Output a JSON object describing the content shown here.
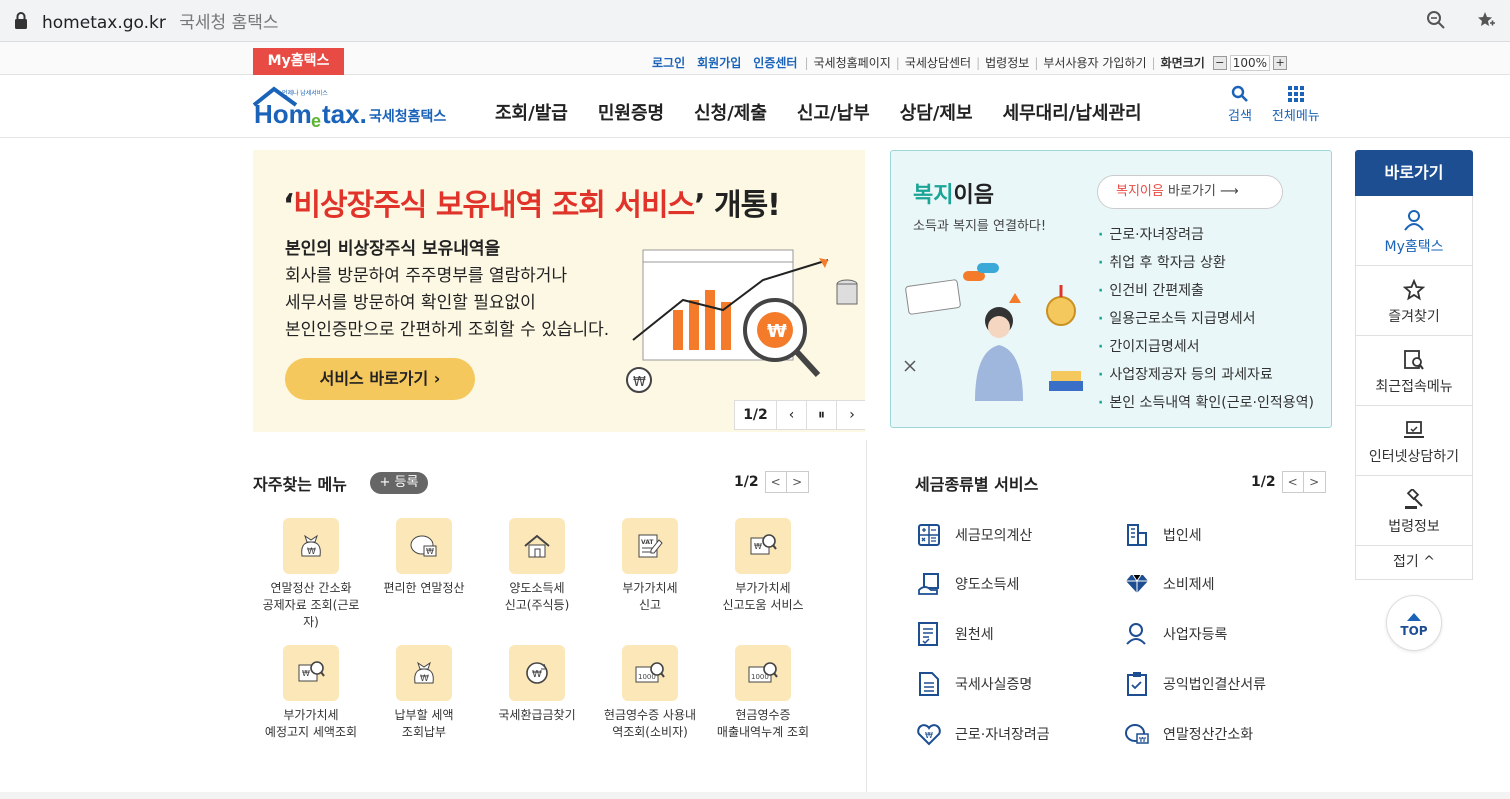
{
  "browser": {
    "host": "hometax.go.kr",
    "title": "국세청 홈택스"
  },
  "topbar": {
    "my_tab": "My홈택스",
    "links_bold": [
      "로그인",
      "회원가입",
      "인증센터"
    ],
    "links": [
      "국세청홈페이지",
      "국세상담센터",
      "법령정보",
      "부서사용자 가입하기"
    ],
    "zoom_label": "화면크기",
    "zoom_value": "100%"
  },
  "logo": {
    "small": "언제나 납세서비스",
    "main": "Hometax.",
    "sub": "국세청홈택스"
  },
  "nav": [
    "조회/발급",
    "민원증명",
    "신청/제출",
    "신고/납부",
    "상담/제보",
    "세무대리/납세관리"
  ],
  "gnb_icons": {
    "search": "검색",
    "all_menu": "전체메뉴"
  },
  "banner": {
    "title_pre": "‘",
    "title_red": "비상장주식 보유내역 조회 서비스",
    "title_post": "’ 개통!",
    "line1": "본인의 비상장주식 보유내역을",
    "line2": "회사를 방문하여 주주명부를 열람하거나",
    "line3": "세무서를 방문하여 확인할 필요없이",
    "line4": "본인인증만으로 간편하게 조회할 수 있습니다.",
    "button": "서비스 바로가기 ›",
    "page": "1/2",
    "prev": "‹",
    "pause": "⏸",
    "next": "›"
  },
  "welfare": {
    "title_green": "복지",
    "title_rest": "이음",
    "subtitle": "소득과 복지를 연결하다!",
    "btn_red": "복지이음",
    "btn_rest": " 바로가기 ⟶",
    "items": [
      "근로·자녀장려금",
      "취업 후 학자금 상환",
      "인건비 간편제출",
      "일용근로소득 지급명세서",
      "간이지급명세서",
      "사업장제공자 등의 과세자료",
      "본인 소득내역 확인(근로·인적용역)"
    ]
  },
  "quick": {
    "header": "바로가기",
    "items": [
      "My홈택스",
      "즐겨찾기",
      "최근접속메뉴",
      "인터넷상담하기",
      "법령정보"
    ],
    "fold": "접기 ^",
    "top": "TOP"
  },
  "frequent": {
    "title": "자주찾는 메뉴",
    "register": "+ 등록",
    "page": "1/2",
    "items": [
      [
        "연말정산 간소화",
        "공제자료 조회(근로",
        "자)"
      ],
      [
        "편리한 연말정산"
      ],
      [
        "양도소득세",
        "신고(주식등)"
      ],
      [
        "부가가치세",
        "신고"
      ],
      [
        "부가가치세",
        "신고도움 서비스"
      ],
      [
        "부가가치세",
        "예정고지 세액조회"
      ],
      [
        "납부할 세액",
        "조회납부"
      ],
      [
        "국세환급금찾기"
      ],
      [
        "현금영수증 사용내",
        "역조회(소비자)"
      ],
      [
        "현금영수증",
        "매출내역누계 조회"
      ]
    ]
  },
  "taxtype": {
    "title": "세금종류별 서비스",
    "page": "1/2",
    "items": [
      "세금모의계산",
      "법인세",
      "양도소득세",
      "소비제세",
      "원천세",
      "사업자등록",
      "국세사실증명",
      "공익법인결산서류",
      "근로·자녀장려금",
      "연말정산간소화"
    ]
  }
}
